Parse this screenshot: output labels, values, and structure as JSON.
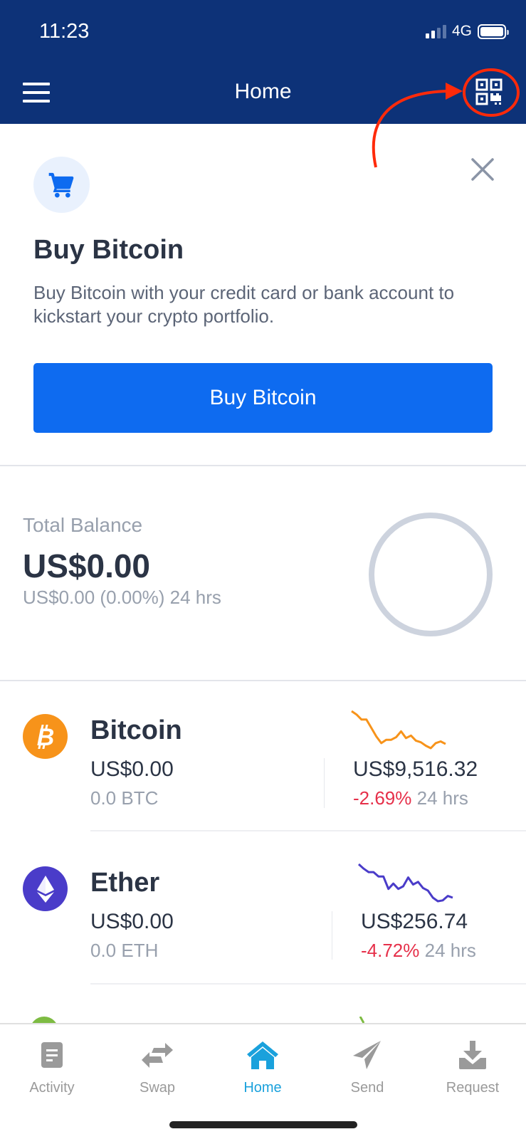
{
  "status_bar": {
    "time": "11:23",
    "network": "4G"
  },
  "header": {
    "title": "Home",
    "menu_icon": "hamburger-menu-icon",
    "qr_icon": "qr-code-scan-icon"
  },
  "annotation": {
    "type": "red arrow and circle highlighting QR icon",
    "color": "#ff2a0a"
  },
  "promo": {
    "icon": "shopping-cart-icon",
    "title": "Buy Bitcoin",
    "description": "Buy Bitcoin with your credit card or bank account to kickstart your crypto portfolio.",
    "button_label": "Buy Bitcoin",
    "close_icon": "close-icon"
  },
  "balance": {
    "label": "Total Balance",
    "value": "US$0.00",
    "change": "US$0.00 (0.00%) 24 hrs"
  },
  "assets": [
    {
      "name": "Bitcoin",
      "fiat_balance": "US$0.00",
      "crypto_balance": "0.0 BTC",
      "price": "US$9,516.32",
      "change_pct": "-2.69%",
      "change_period": "24 hrs",
      "color": "#f7931a",
      "icon": "bitcoin-icon",
      "sparkline": [
        100,
        96,
        90,
        90,
        80,
        70,
        62,
        66,
        66,
        69,
        76,
        68,
        71,
        65,
        63,
        59,
        56,
        62,
        64,
        61
      ]
    },
    {
      "name": "Ether",
      "fiat_balance": "US$0.00",
      "crypto_balance": "0.0 ETH",
      "price": "US$256.74",
      "change_pct": "-4.72%",
      "change_period": "24 hrs",
      "color": "#4a3cc9",
      "icon": "ether-icon",
      "sparkline": [
        100,
        95,
        91,
        91,
        86,
        86,
        72,
        78,
        72,
        75,
        85,
        77,
        80,
        73,
        70,
        62,
        58,
        59,
        64,
        62
      ]
    }
  ],
  "tabs": [
    {
      "label": "Activity",
      "icon": "activity-document-icon",
      "active": false
    },
    {
      "label": "Swap",
      "icon": "swap-arrows-icon",
      "active": false
    },
    {
      "label": "Home",
      "icon": "home-icon",
      "active": true
    },
    {
      "label": "Send",
      "icon": "send-paper-plane-icon",
      "active": false
    },
    {
      "label": "Request",
      "icon": "request-download-icon",
      "active": false
    }
  ]
}
